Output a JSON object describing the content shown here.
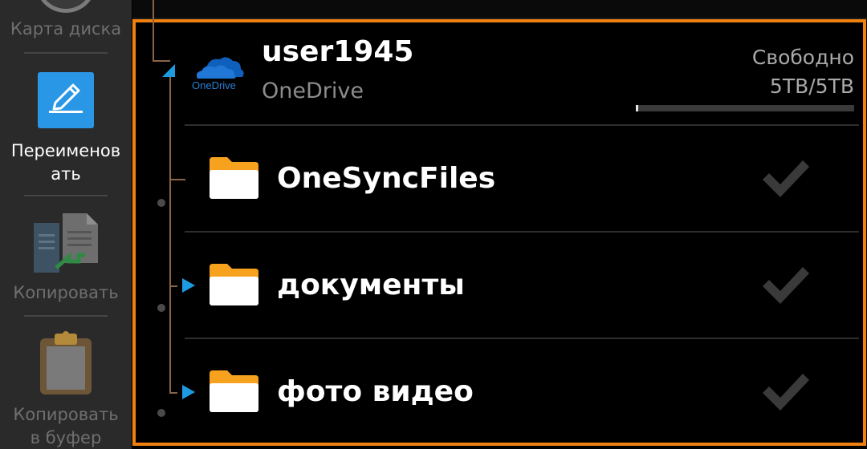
{
  "sidebar": {
    "items": [
      {
        "label": "Карта диска",
        "icon": "disk-map-icon",
        "active": false
      },
      {
        "label": "Переименовать",
        "icon": "rename-icon",
        "active": true
      },
      {
        "label": "Копировать",
        "icon": "copy-icon",
        "active": false
      },
      {
        "label": "Копировать в буфер",
        "icon": "clipboard-icon",
        "active": false
      }
    ]
  },
  "account": {
    "name": "user1945",
    "service": "OneDrive",
    "logo_text": "OneDrive",
    "free_label": "Свободно",
    "free_value": "5TB/5TB",
    "usage_fraction": 0.01
  },
  "folders": [
    {
      "name": "OneSyncFiles",
      "expandable": false,
      "checked": true
    },
    {
      "name": "документы",
      "expandable": true,
      "checked": true
    },
    {
      "name": "фото видео",
      "expandable": true,
      "checked": true
    }
  ],
  "colors": {
    "accent": "#f0800f",
    "sidebar_bg": "#2a2a2a",
    "rename_icon": "#2a96e6",
    "tree_arrow": "#1e9be0",
    "folder": "#f7a21e",
    "onedrive": "#0f5fbd"
  }
}
